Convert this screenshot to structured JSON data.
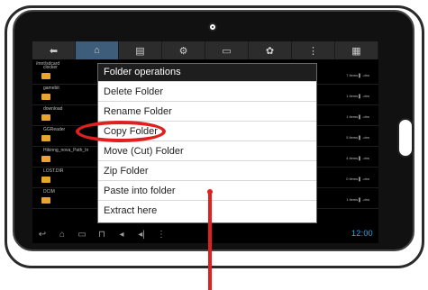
{
  "tabs": [
    "⬅",
    "⌂",
    "▤",
    "⚙",
    "▭",
    "✿",
    "⋮",
    "▦"
  ],
  "path": "/mnt/sdcard",
  "files": [
    {
      "name": "clocker",
      "meta": "7 items ▌ -drw"
    },
    {
      "name": "gamebit",
      "meta": "1 items ▌ -drw"
    },
    {
      "name": "download",
      "meta": "1 items ▌ -drw"
    },
    {
      "name": "GGReader",
      "meta": "5 items ▌ -drw"
    },
    {
      "name": "Hikinng_nova_Path_In",
      "meta": "4 items ▌ -drw"
    },
    {
      "name": "LOST.DIR",
      "meta": "0 items ▌ -drw"
    },
    {
      "name": "DCIM",
      "meta": "1 items ▌ -drw"
    }
  ],
  "menu": {
    "title": "Folder operations",
    "items": [
      "Delete Folder",
      "Rename Folder",
      "Copy Folder",
      "Move (Cut) Folder",
      "Zip Folder",
      "Paste into folder",
      "Extract here"
    ]
  },
  "navbar": {
    "icons": [
      "↩",
      "⌂",
      "▭",
      "⊓",
      "◂",
      "◂|",
      "⋮"
    ],
    "clock": "12:00"
  },
  "colors": {
    "accent": "#e0201f",
    "clock": "#2ea7e0",
    "folder": "#e8a431"
  }
}
